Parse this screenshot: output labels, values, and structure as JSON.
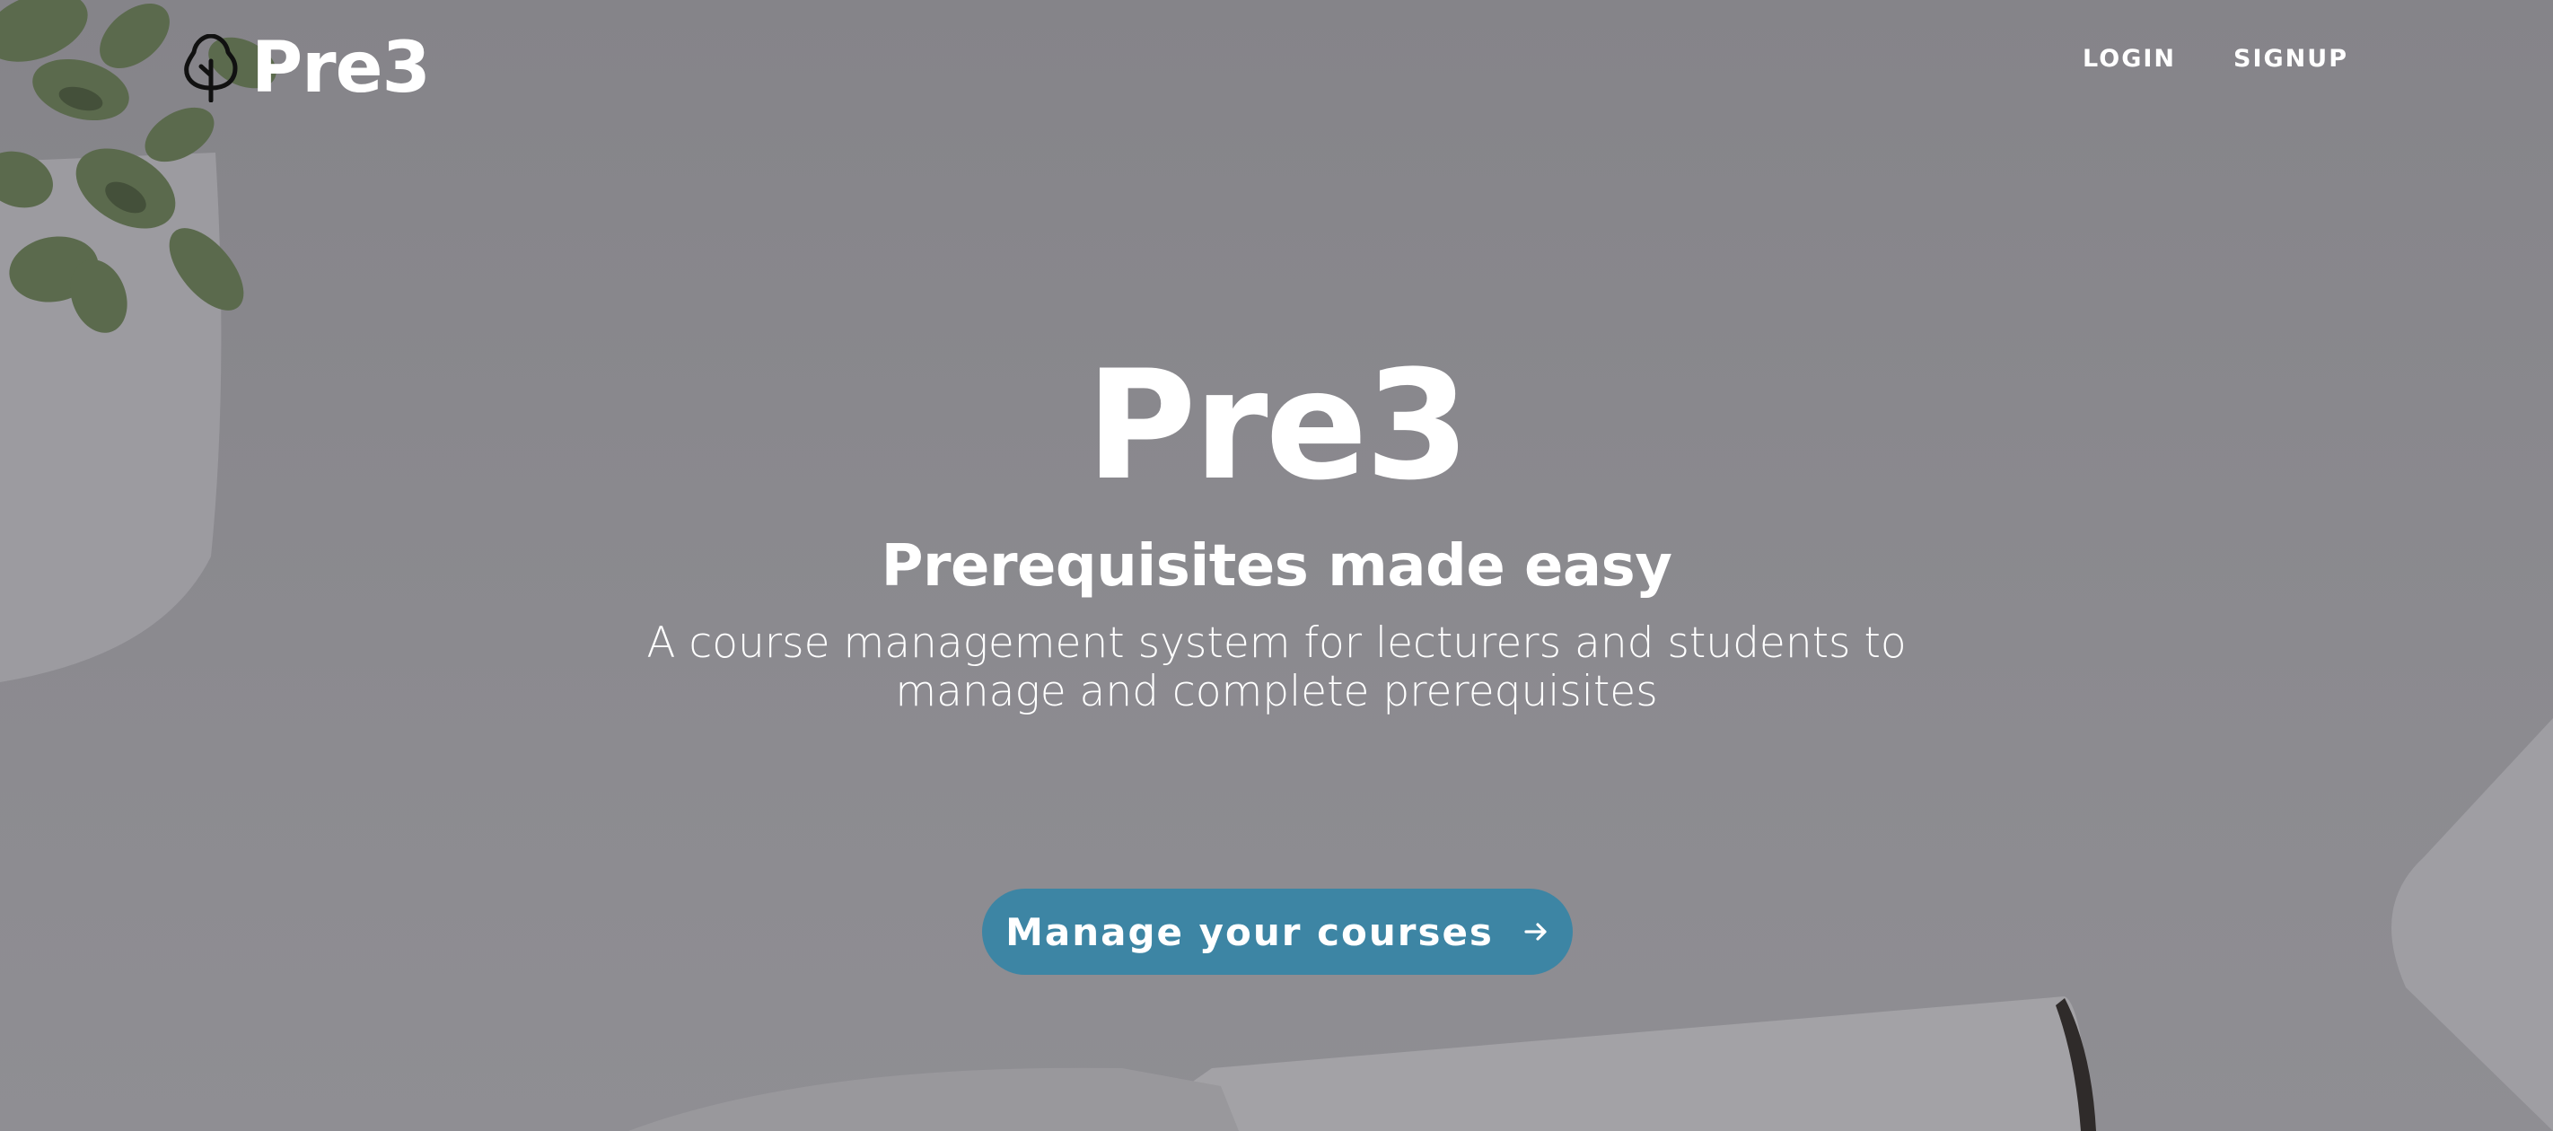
{
  "header": {
    "brand": "Pre3",
    "nav": [
      {
        "label": "LOGIN"
      },
      {
        "label": "SIGNUP"
      }
    ]
  },
  "hero": {
    "title": "Pre3",
    "subtitle": "Prerequisites made easy",
    "description_lines": [
      "A course management system for lecturers and students to",
      "manage and complete prerequisites"
    ],
    "cta_label": "Manage your courses",
    "cta_icon": "arrow-right-icon"
  },
  "colors": {
    "cta_background": "#3d85a4",
    "overlay": "#86858a",
    "text": "#ffffff"
  }
}
